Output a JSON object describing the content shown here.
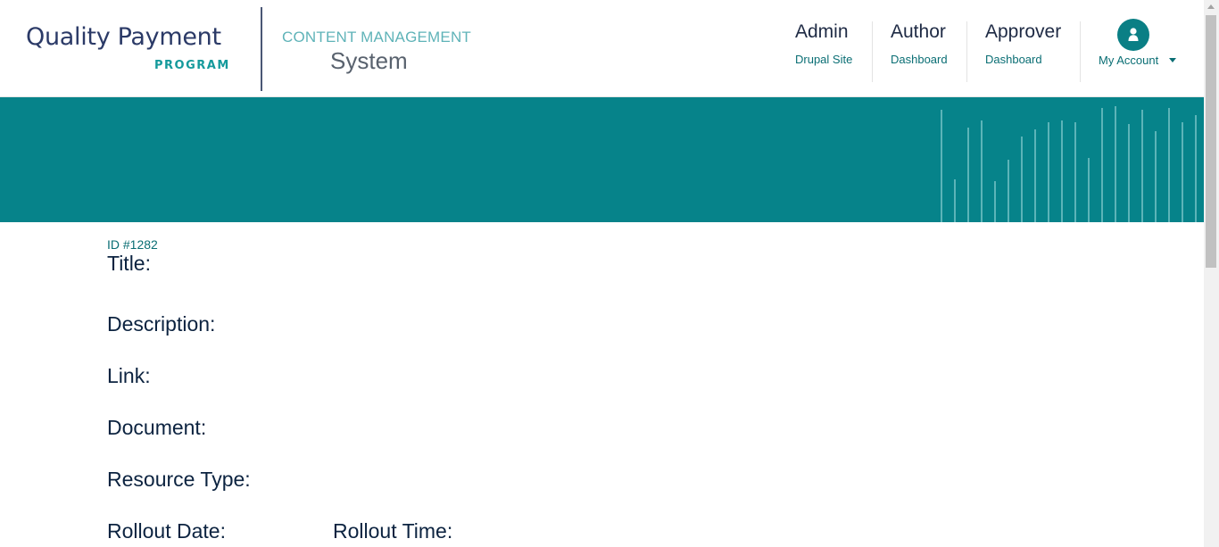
{
  "logo": {
    "quality": "Quality Payment",
    "program": "PROGRAM"
  },
  "cms": {
    "line1": "CONTENT MANAGEMENT",
    "line2": "System"
  },
  "nav": [
    {
      "title": "Admin",
      "sub": "Drupal Site"
    },
    {
      "title": "Author",
      "sub": "Dashboard"
    },
    {
      "title": "Approver",
      "sub": "Dashboard"
    }
  ],
  "account": {
    "label": "My Account"
  },
  "record": {
    "id": "ID #1282",
    "labels": {
      "title": "Title:",
      "description": "Description:",
      "link": "Link:",
      "document": "Document:",
      "resource_type": "Resource Type:",
      "rollout_date": "Rollout Date:",
      "rollout_time": "Rollout Time:"
    }
  },
  "colors": {
    "banner": "#06838a",
    "accent": "#0a7f85",
    "heading": "#0c2340"
  }
}
